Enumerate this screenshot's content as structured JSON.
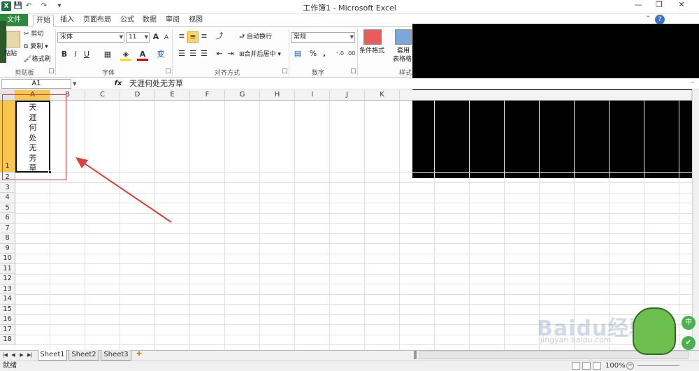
{
  "titlebar": {
    "app_icon": "X",
    "title": "工作簿1 - Microsoft Excel",
    "quick_access": [
      "save-icon",
      "undo-icon",
      "redo-icon",
      "customize-icon"
    ],
    "controls": {
      "minimize": "—",
      "restore": "❐",
      "close": "✕"
    }
  },
  "tabs": [
    "文件",
    "开始",
    "插入",
    "页面布局",
    "公式",
    "数据",
    "审阅",
    "视图"
  ],
  "ribbon": {
    "clipboard": {
      "paste": "粘贴",
      "cut": "剪切",
      "copy": "复制",
      "format_painter": "格式刷",
      "label": "剪贴板"
    },
    "font": {
      "name": "宋体",
      "size": "11",
      "bold": "B",
      "italic": "I",
      "underline": "U",
      "grow": "A",
      "shrink": "A",
      "font_color": "A",
      "phonetic": "变",
      "label": "字体"
    },
    "alignment": {
      "wrap": "自动换行",
      "merge": "合并后居中",
      "label": "对齐方式"
    },
    "number": {
      "format": "常规",
      "percent": "%",
      "comma": ",",
      "label": "数字"
    },
    "styles": {
      "conditional": "条件格式",
      "table": "套用",
      "table2": "表格格式",
      "label": "样式"
    }
  },
  "formula_bar": {
    "name_box": "A1",
    "fx": "fx",
    "content": "天涯何处无芳草"
  },
  "columns": [
    "A",
    "B",
    "C",
    "D",
    "E",
    "F",
    "G",
    "H",
    "I",
    "J",
    "K"
  ],
  "rows": [
    "1",
    "2",
    "3",
    "4",
    "5",
    "6",
    "7",
    "8",
    "9",
    "10",
    "11",
    "12",
    "13",
    "14",
    "15",
    "16",
    "17",
    "18"
  ],
  "cell_a1_chars": [
    "天",
    "涯",
    "何",
    "处",
    "无",
    "芳",
    "草"
  ],
  "sheets": [
    "Sheet1",
    "Sheet2",
    "Sheet3"
  ],
  "status": {
    "ready": "就绪",
    "zoom": "100%"
  },
  "watermark": {
    "main": "Baidu经验",
    "sub": "jingyan.baidu.com"
  },
  "side_buttons": [
    "中",
    "✔"
  ],
  "colors": {
    "file_tab": "#2a8a3b",
    "annotation": "#e23c3c",
    "selected_header": "#f9c74f"
  }
}
